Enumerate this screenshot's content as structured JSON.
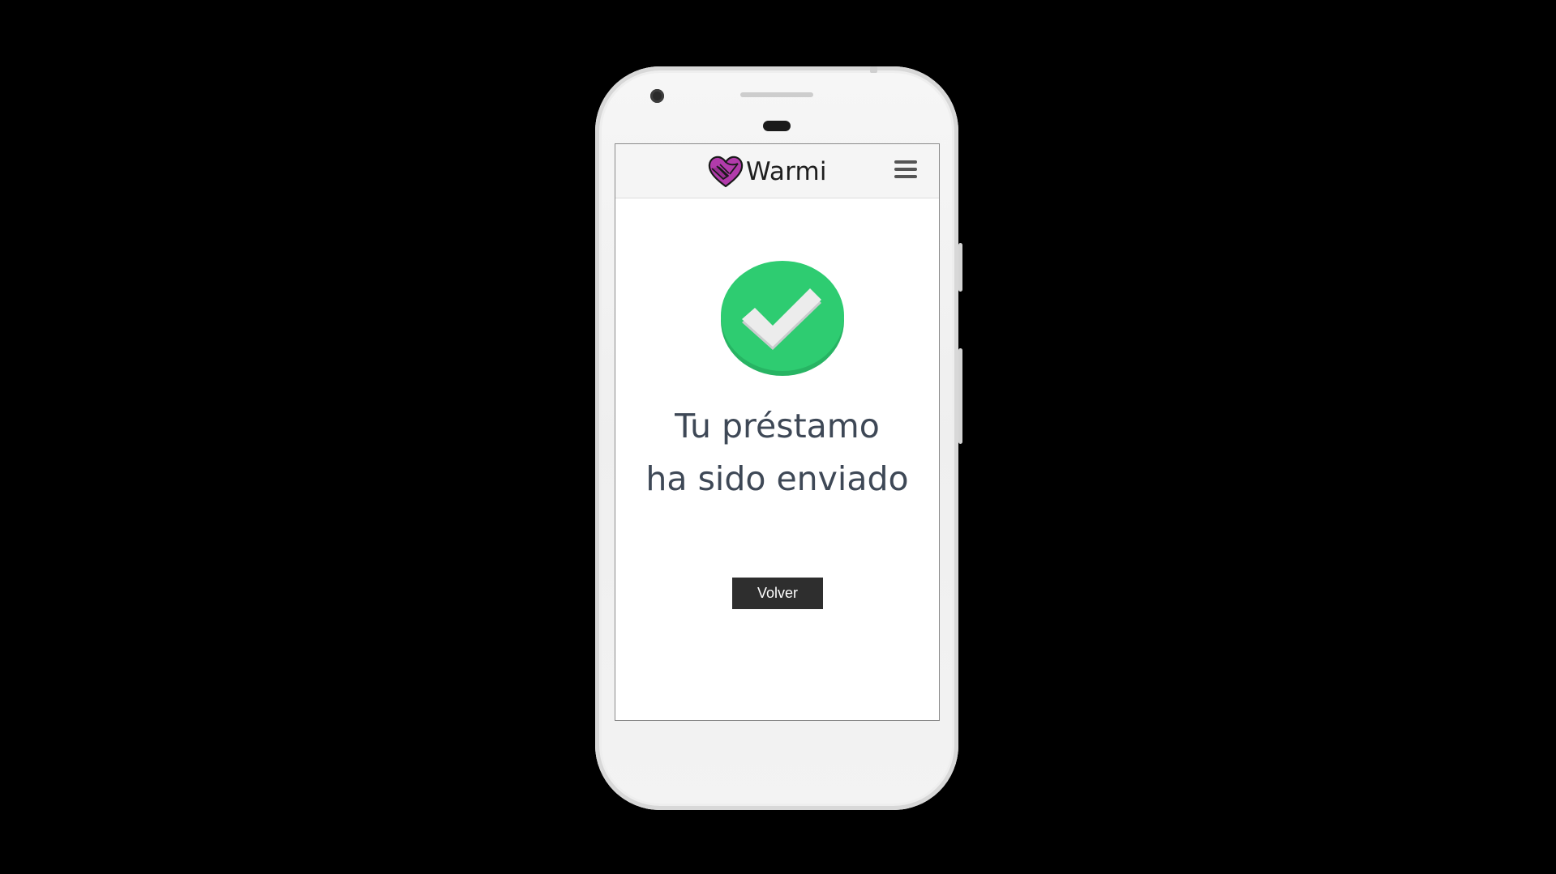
{
  "app": {
    "brand_name": "Warmi",
    "brand_logo_icon": "heart-hands-icon",
    "menu_icon": "hamburger-menu-icon"
  },
  "success": {
    "icon": "check-circle-icon",
    "line1": "Tu préstamo",
    "line2": "ha sido enviado"
  },
  "actions": {
    "back_label": "Volver"
  },
  "colors": {
    "background": "#000000",
    "check_green": "#2ecc71",
    "logo_purple": "#b23bab",
    "text": "#3e4856",
    "button": "#2e2e2e"
  }
}
